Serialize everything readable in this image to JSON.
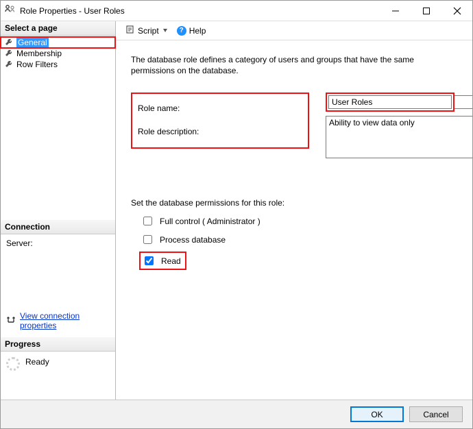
{
  "window": {
    "title": "Role Properties - User Roles"
  },
  "sidebar": {
    "select_page_header": "Select a page",
    "pages": [
      {
        "label": "General",
        "selected": true
      },
      {
        "label": "Membership",
        "selected": false
      },
      {
        "label": "Row Filters",
        "selected": false
      }
    ],
    "connection_header": "Connection",
    "server_label": "Server:",
    "connection_link": "View connection properties",
    "progress_header": "Progress",
    "progress_status": "Ready"
  },
  "toolbar": {
    "script_label": "Script",
    "help_label": "Help"
  },
  "content": {
    "intro": "The database role defines a category of users and groups that have the same permissions on the database.",
    "role_name_label": "Role name:",
    "role_name_value": "User Roles",
    "role_desc_label": "Role description:",
    "role_desc_value": "Ability to view data only",
    "perms_label": "Set the database permissions for this role:",
    "perm_full": "Full control ( Administrator )",
    "perm_process": "Process database",
    "perm_read": "Read"
  },
  "footer": {
    "ok": "OK",
    "cancel": "Cancel"
  }
}
